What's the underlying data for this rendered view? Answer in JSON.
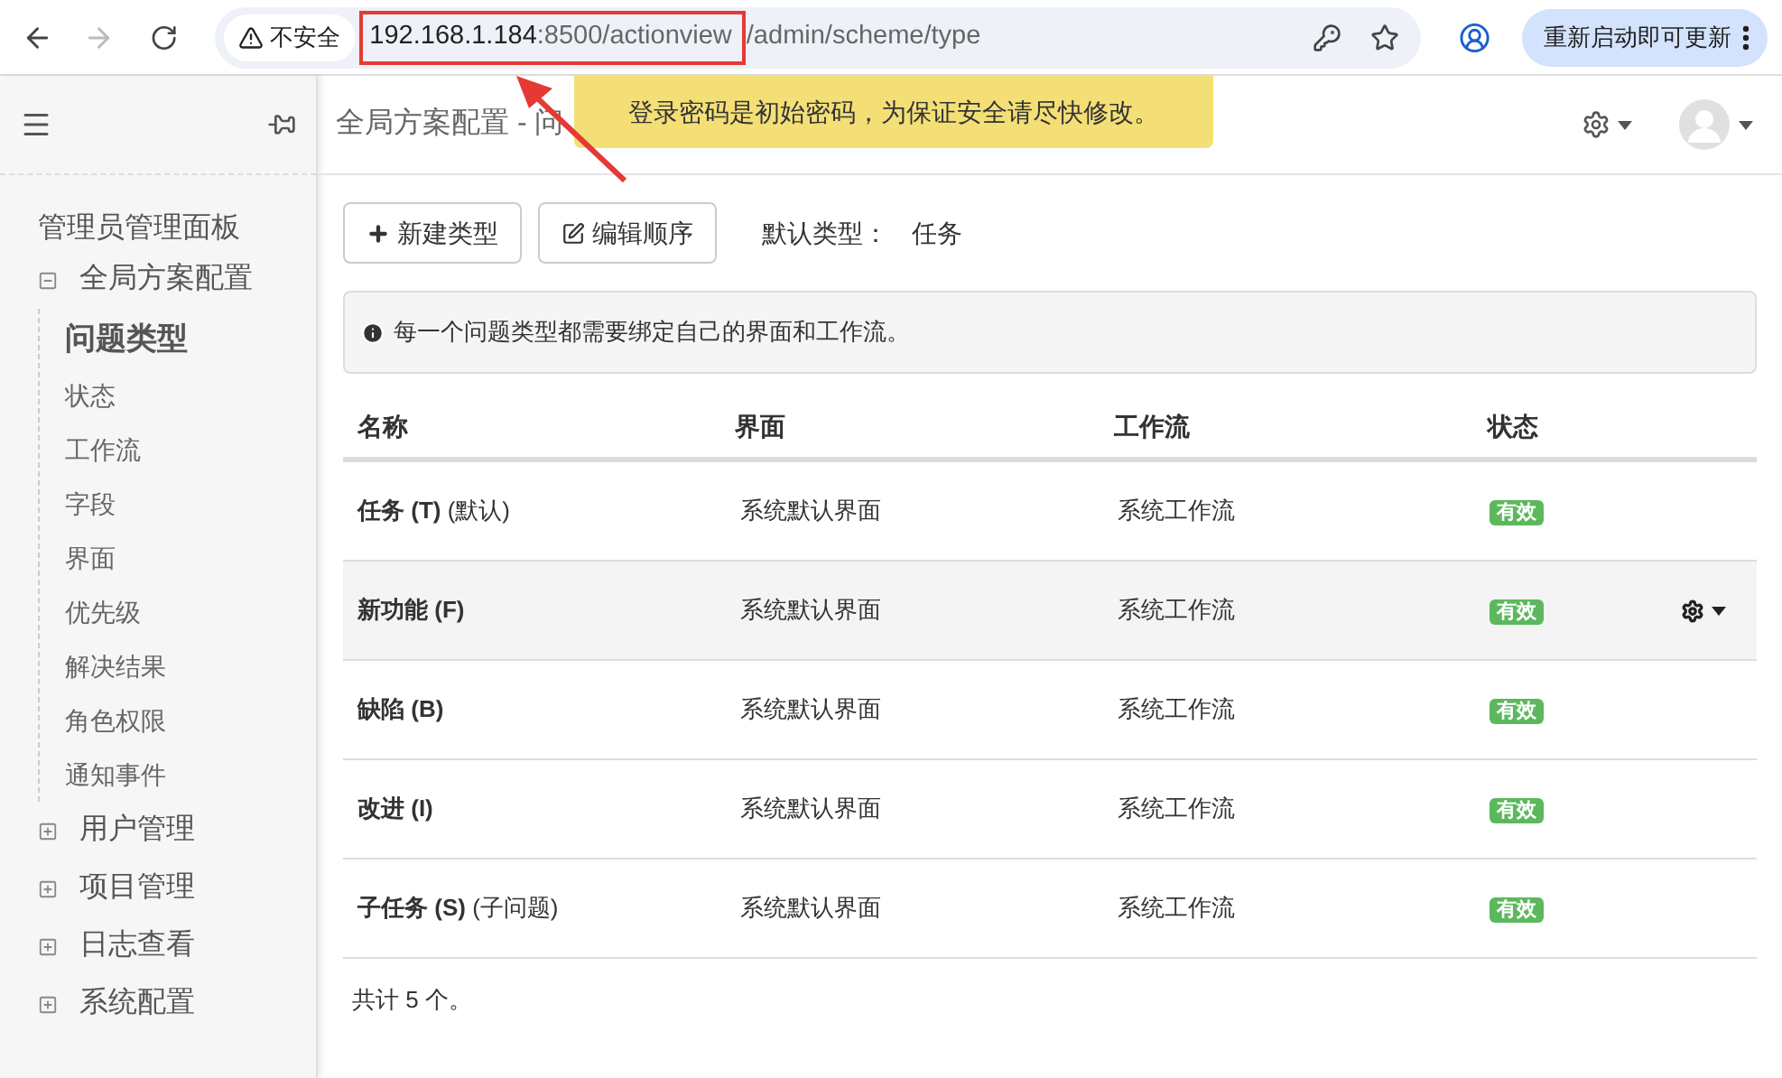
{
  "browser": {
    "security_label": "不安全",
    "url_host": "192.168.1.184",
    "url_path": ":8500/actionview",
    "url_rest": "/admin/scheme/type",
    "update_button": "重新启动即可更新"
  },
  "toast": {
    "message": "登录密码是初始密码，为保证安全请尽快修改。"
  },
  "header": {
    "title": "全局方案配置 - 问"
  },
  "sidebar": {
    "title": "管理员管理面板",
    "groups": [
      {
        "label": "全局方案配置",
        "expanded": true,
        "children": [
          {
            "label": "问题类型",
            "selected": true
          },
          {
            "label": "状态",
            "selected": false
          },
          {
            "label": "工作流",
            "selected": false
          },
          {
            "label": "字段",
            "selected": false
          },
          {
            "label": "界面",
            "selected": false
          },
          {
            "label": "优先级",
            "selected": false
          },
          {
            "label": "解决结果",
            "selected": false
          },
          {
            "label": "角色权限",
            "selected": false
          },
          {
            "label": "通知事件",
            "selected": false
          }
        ]
      },
      {
        "label": "用户管理",
        "expanded": false
      },
      {
        "label": "项目管理",
        "expanded": false
      },
      {
        "label": "日志查看",
        "expanded": false
      },
      {
        "label": "系统配置",
        "expanded": false
      }
    ]
  },
  "toolbar": {
    "buttons": [
      {
        "label": "新建类型",
        "kind": "add"
      },
      {
        "label": "编辑顺序",
        "kind": "edit"
      }
    ],
    "default_label": "默认类型：",
    "default_value": "任务"
  },
  "info": {
    "text": "每一个问题类型都需要绑定自己的界面和工作流。"
  },
  "table": {
    "columns": [
      "名称",
      "界面",
      "工作流",
      "状态"
    ],
    "rows": [
      {
        "name": "任务 (T)",
        "note": "(默认)",
        "screen": "系统默认界面",
        "workflow": "系统工作流",
        "status": "有效",
        "selected": false
      },
      {
        "name": "新功能 (F)",
        "screen": "系统默认界面",
        "workflow": "系统工作流",
        "status": "有效",
        "selected": true
      },
      {
        "name": "缺陷 (B)",
        "screen": "系统默认界面",
        "workflow": "系统工作流",
        "status": "有效",
        "selected": false
      },
      {
        "name": "改进 (I)",
        "screen": "系统默认界面",
        "workflow": "系统工作流",
        "status": "有效",
        "selected": false
      },
      {
        "name": "子任务 (S)",
        "note": "(子问题)",
        "screen": "系统默认界面",
        "workflow": "系统工作流",
        "status": "有效",
        "selected": false
      }
    ]
  },
  "footer": {
    "total": "共计 5 个。"
  }
}
